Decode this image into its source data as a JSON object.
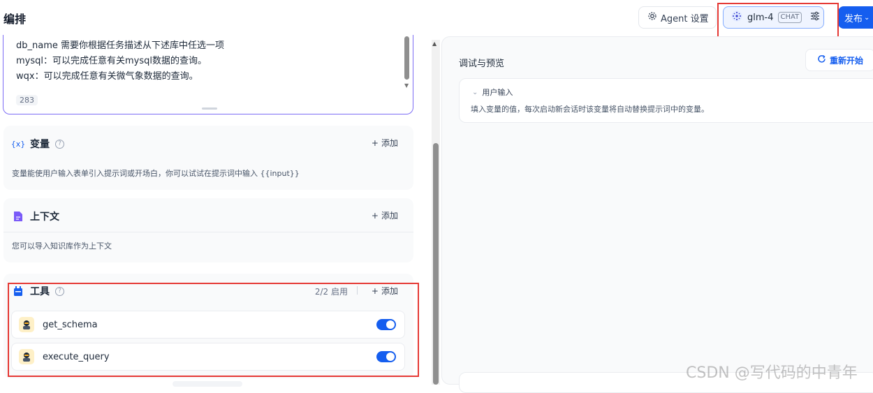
{
  "header": {
    "title": "编排",
    "agent_settings_label": "Agent 设置",
    "model_name": "glm-4",
    "model_badge": "CHAT",
    "publish_label": "发布"
  },
  "prompt": {
    "lines": [
      "db_name 需要你根据任务描述从下述库中任选一项",
      "mysql：可以完成任意有关mysql数据的查询。",
      "wqx：可以完成任意有关微气象数据的查询。"
    ],
    "char_count": "283"
  },
  "variables": {
    "title": "变量",
    "add_label": "添加",
    "description": "变量能使用户输入表单引入提示词或开场白，你可以试试在提示词中输入 {{input}}"
  },
  "context": {
    "title": "上下文",
    "add_label": "添加",
    "description": "您可以导入知识库作为上下文"
  },
  "tools": {
    "title": "工具",
    "enabled_count": "2/2 启用",
    "add_label": "添加",
    "items": [
      {
        "name": "get_schema",
        "enabled": true
      },
      {
        "name": "execute_query",
        "enabled": true
      }
    ]
  },
  "debug": {
    "title": "调试与预览",
    "restart_label": "重新开始",
    "user_input_title": "用户输入",
    "user_input_desc": "填入变量的值，每次启动新会话时该变量将自动替换提示词中的变量。"
  },
  "watermark": "CSDN @写代码的中青年",
  "colors": {
    "accent": "#155eef",
    "highlight_box": "#e53935",
    "prompt_border": "#7c6cf5"
  }
}
